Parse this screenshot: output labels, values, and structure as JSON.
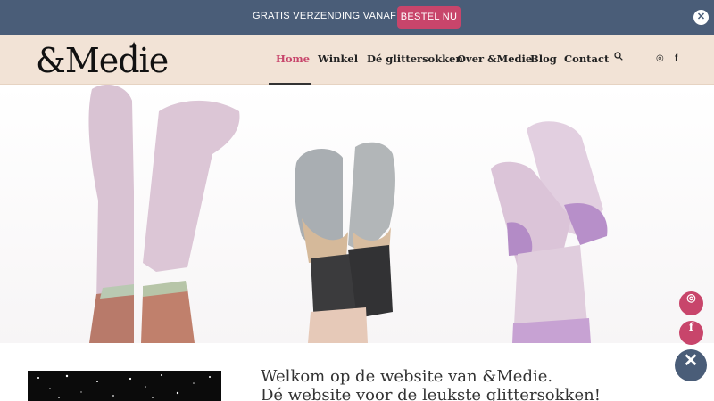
{
  "announcement": {
    "text": "GRATIS VERZENDING VANAF € 25",
    "button_label": "BESTEL NU",
    "close_glyph": "✕"
  },
  "header": {
    "logo_text": "&Medie",
    "nav": [
      "Home",
      "Winkel",
      "Dé glittersokken",
      "Over &Medie",
      "Blog",
      "Contact"
    ],
    "active_nav": "Home",
    "icons": [
      "search-icon",
      "instagram-icon",
      "facebook-icon"
    ],
    "social": {
      "instagram_glyph": "◎",
      "facebook_glyph": "f"
    }
  },
  "floating": {
    "instagram_glyph": "◎",
    "facebook_glyph": "f",
    "close_glyph": "✕"
  },
  "content": {
    "welcome_line1": "Welkom op de website van &Medie.",
    "welcome_line2": "Dé website voor de leukste glittersokken!"
  },
  "colors": {
    "topbar": "#4a5d78",
    "accent": "#c8456b",
    "header_bg": "#f2e3d6"
  }
}
